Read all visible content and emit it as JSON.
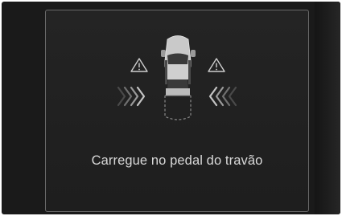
{
  "screen": {
    "message": "Carregue no pedal do travão"
  },
  "icons": {
    "warning_left": "warning-triangle-icon",
    "warning_right": "warning-triangle-icon",
    "arrows_left": "chevrons-right-icon",
    "arrows_right": "chevrons-left-icon",
    "vehicle": "car-top-view-icon"
  },
  "colors": {
    "background": "#1a1a1a",
    "panel_border": "#6a6a6a",
    "text": "#d9d9d9",
    "icon": "#cfcfcf"
  }
}
